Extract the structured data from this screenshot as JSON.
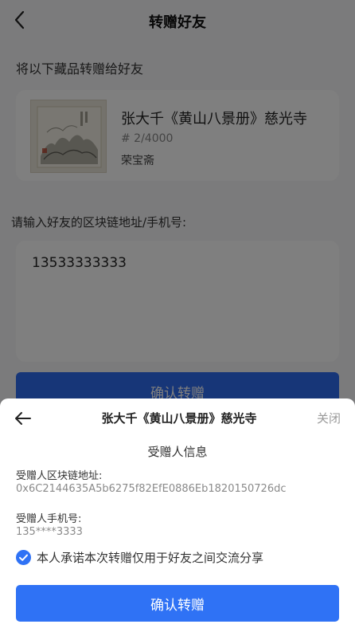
{
  "nav": {
    "title": "转赠好友"
  },
  "item_section": {
    "label": "将以下藏品转赠给好友"
  },
  "item": {
    "title": "张大千《黄山八景册》慈光寺",
    "serial": "# 2/4000",
    "publisher": "荣宝斋"
  },
  "recipient_input": {
    "label": "请输入好友的区块链地址/手机号:",
    "value": "13533333333"
  },
  "page_confirm": {
    "label": "确认转赠"
  },
  "sheet": {
    "title": "张大千《黄山八景册》慈光寺",
    "close_label": "关闭",
    "subtitle": "受赠人信息",
    "address_label": "受赠人区块链地址:",
    "address_value": "0x6C2144635A5b6275f82EfE0886Eb1820150726dc",
    "phone_label": "受赠人手机号:",
    "phone_value": "135****3333",
    "agreement_text": "本人承诺本次转赠仅用于好友之间交流分享",
    "agreement_checked": true,
    "confirm_label": "确认转赠"
  },
  "colors": {
    "accent": "#2f72f5",
    "overlay": "rgba(0,0,0,0.5)"
  }
}
